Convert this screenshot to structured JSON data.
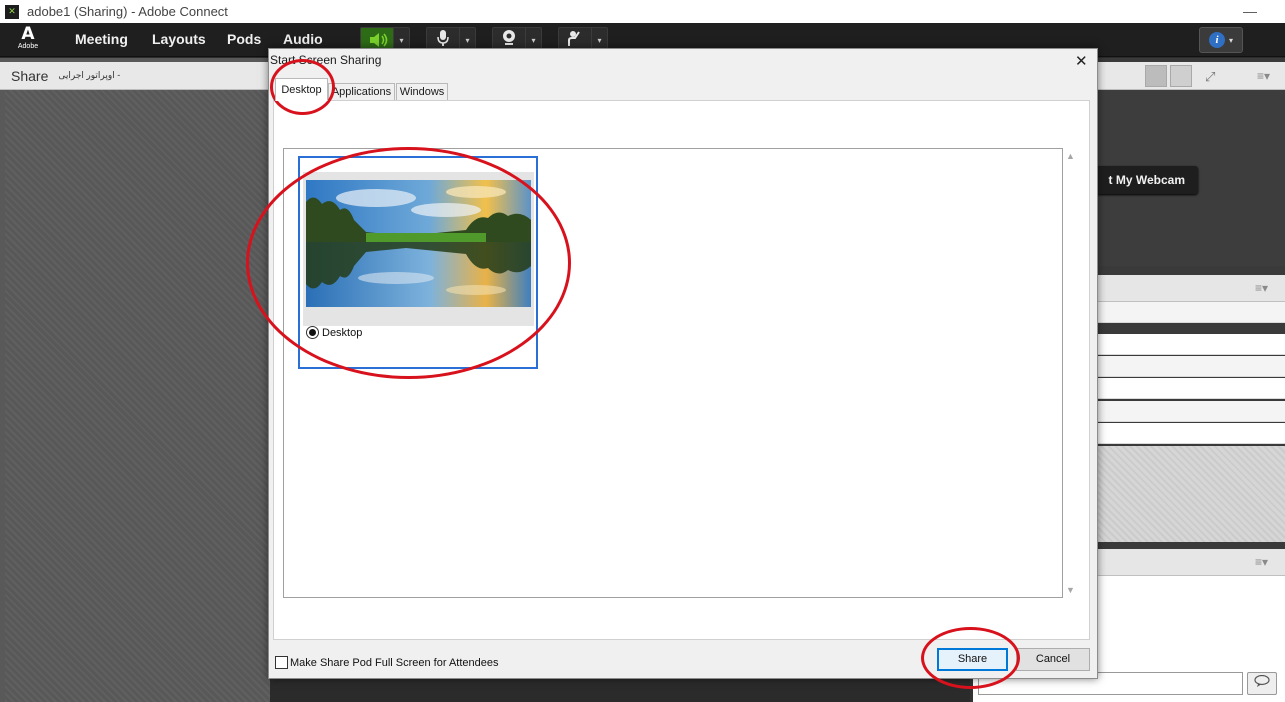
{
  "window": {
    "title": "adobe1 (Sharing) - Adobe Connect",
    "minimize_glyph": "—"
  },
  "app": {
    "logo_text": "Adobe",
    "menu": [
      "Meeting",
      "Layouts",
      "Pods",
      "Audio"
    ],
    "toolbar": {
      "speaker_icon": "speaker-icon",
      "mic_icon": "microphone-icon",
      "webcam_icon": "webcam-icon",
      "raise_hand_icon": "raise-hand-icon",
      "dropdown_glyph": "▾",
      "speaker_active_color": "#2e6b16"
    },
    "help_glyph": "i"
  },
  "share_pod": {
    "title": "Share",
    "subtitle": "اوپراتور اجرایی -"
  },
  "webcam_pod": {
    "button_label": "t My Webcam"
  },
  "dialog": {
    "title": "Start Screen Sharing",
    "close_glyph": "✕",
    "tabs": [
      "Desktop",
      "Applications",
      "Windows"
    ],
    "selected_tab": "Desktop",
    "desktop_item": {
      "label": "Desktop",
      "selected": true
    },
    "fullscreen_checkbox": {
      "label": "Make Share Pod Full Screen for Attendees",
      "checked": false
    },
    "share_button": "Share",
    "cancel_button": "Cancel"
  },
  "colors": {
    "annotation": "#d8121c",
    "selection": "#2a6fd6",
    "app_dark": "#1f1f1f"
  }
}
